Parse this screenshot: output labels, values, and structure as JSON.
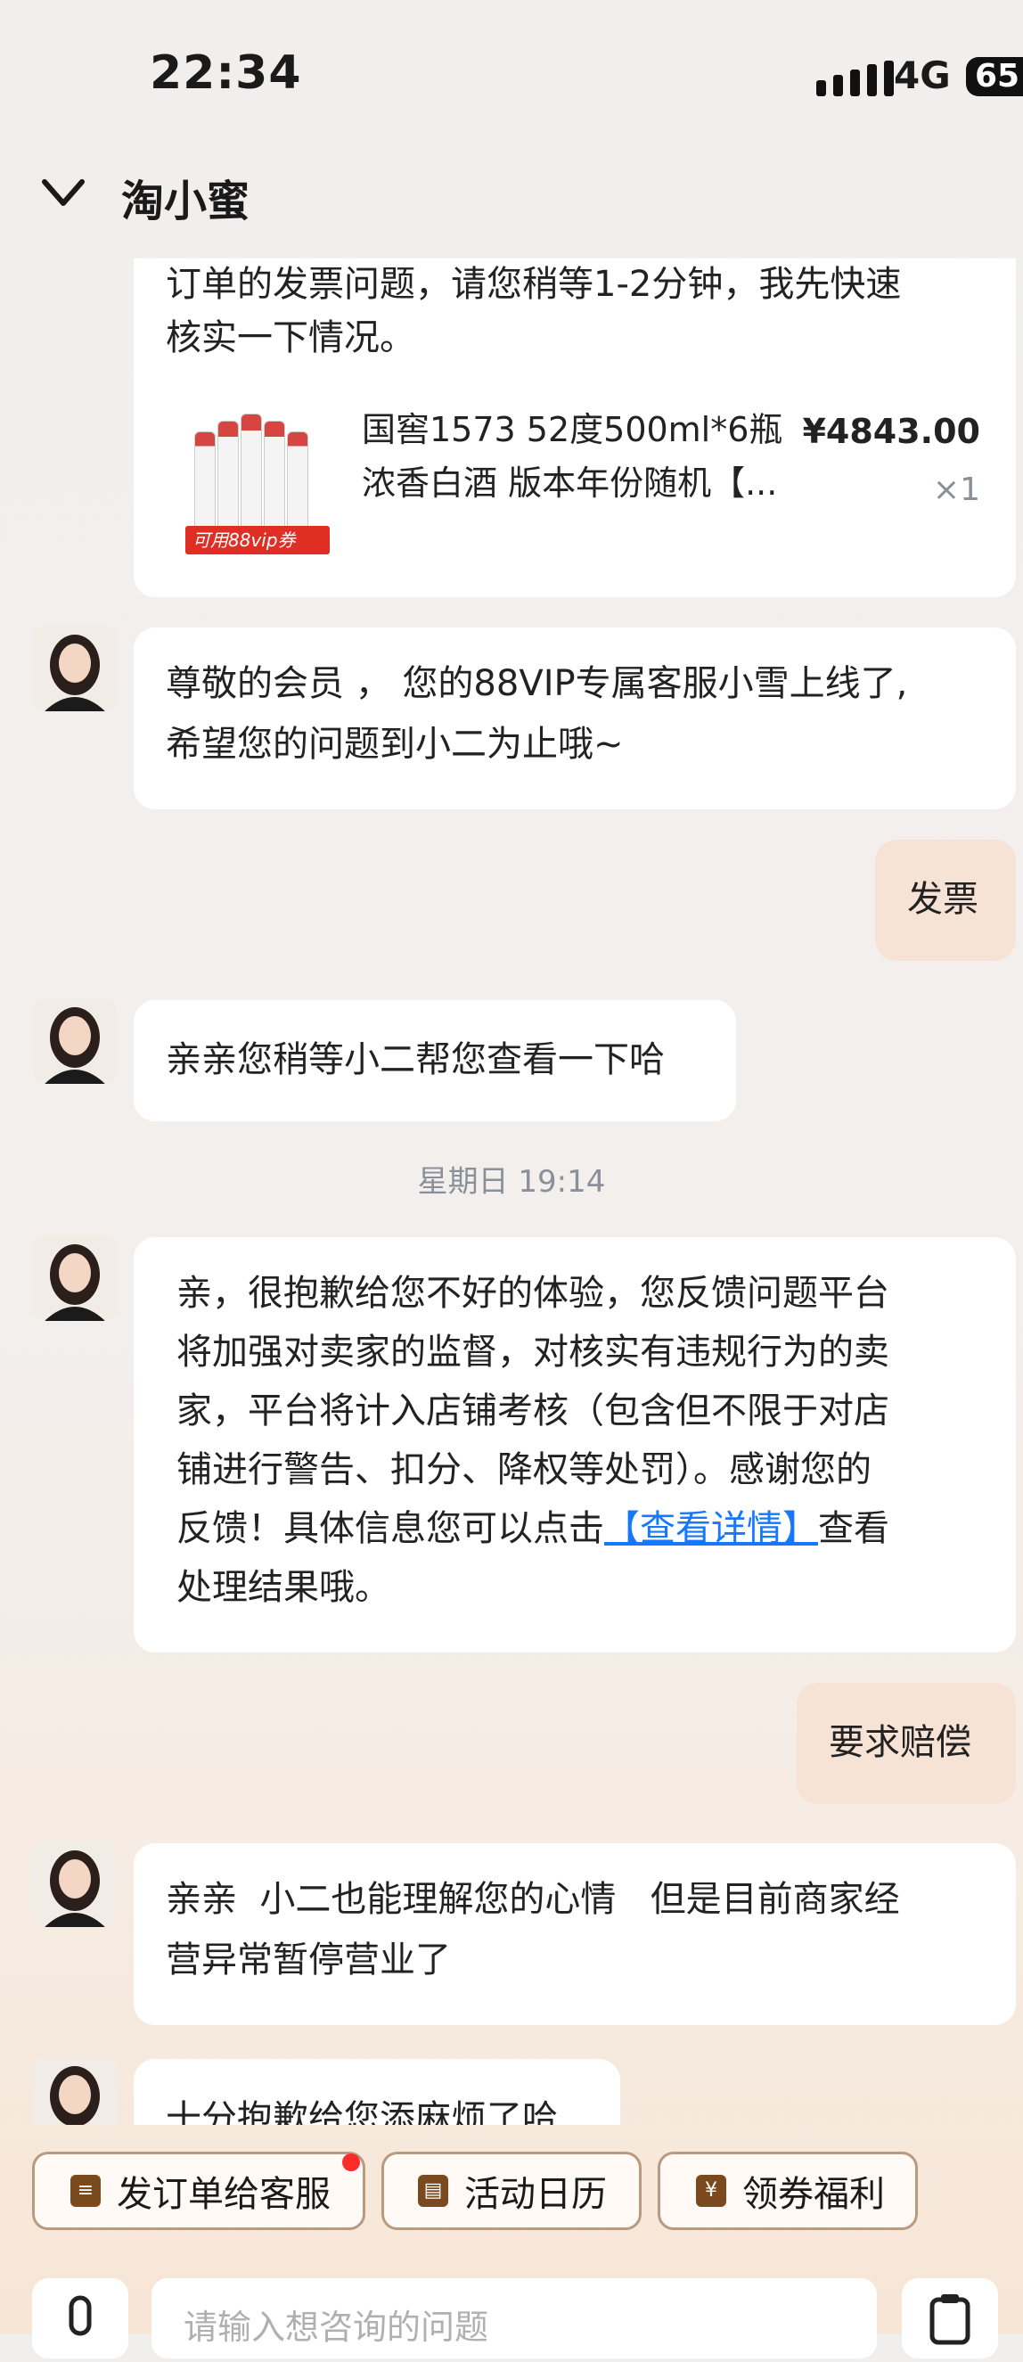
{
  "status": {
    "time": "22:34",
    "network": "4G",
    "battery": "65"
  },
  "header": {
    "title": "淘小蜜",
    "back_icon": "chevron-down-icon"
  },
  "messages": {
    "m1": {
      "line1": "订单的发票问题，请您稍等1-2分钟，我先快速",
      "line2": "核实一下情况。"
    },
    "product": {
      "name_line1": "国窖1573 52度500ml*6瓶",
      "name_line2": "浓香白酒 版本年份随机【...",
      "price": "¥4843.00",
      "qty": "×1",
      "badge": "可用88vip券"
    },
    "m2": {
      "line1": "尊敬的会员 ， 您的88VIP专属客服小雪上线了,",
      "line2": "希望您的问题到小二为止哦~"
    },
    "me1": "发票",
    "m3": "亲亲您稍等小二帮您查看一下哈",
    "timestamp": "星期日 19:14",
    "m4": {
      "line1": "亲，很抱歉给您不好的体验，您反馈问题平台",
      "line2": "将加强对卖家的监督，对核实有违规行为的卖",
      "line3": "家，平台将计入店铺考核（包含但不限于对店",
      "line4": "铺进行警告、扣分、降权等处罚）。感谢您的",
      "line5_pre": "反馈！具体信息您可以点击",
      "line5_link": "【查看详情】",
      "line5_post": "查看",
      "line6": "处理结果哦。"
    },
    "me2": "要求赔偿",
    "m5": {
      "line1": "亲亲  小二也能理解您的心情   但是目前商家经",
      "line2": "营异常暂停营业了"
    },
    "m6": "十分抱歉给您添麻烦了哈"
  },
  "quick_actions": [
    {
      "label": "发订单给客服",
      "icon": "clipboard-icon"
    },
    {
      "label": "活动日历",
      "icon": "calendar-icon"
    },
    {
      "label": "领券福利",
      "icon": "coupon-icon"
    }
  ],
  "input": {
    "placeholder": "请输入想咨询的问题"
  },
  "colors": {
    "link": "#1677ff",
    "my_bubble": "#f6e3d6",
    "badge_red": "#e02e24"
  }
}
